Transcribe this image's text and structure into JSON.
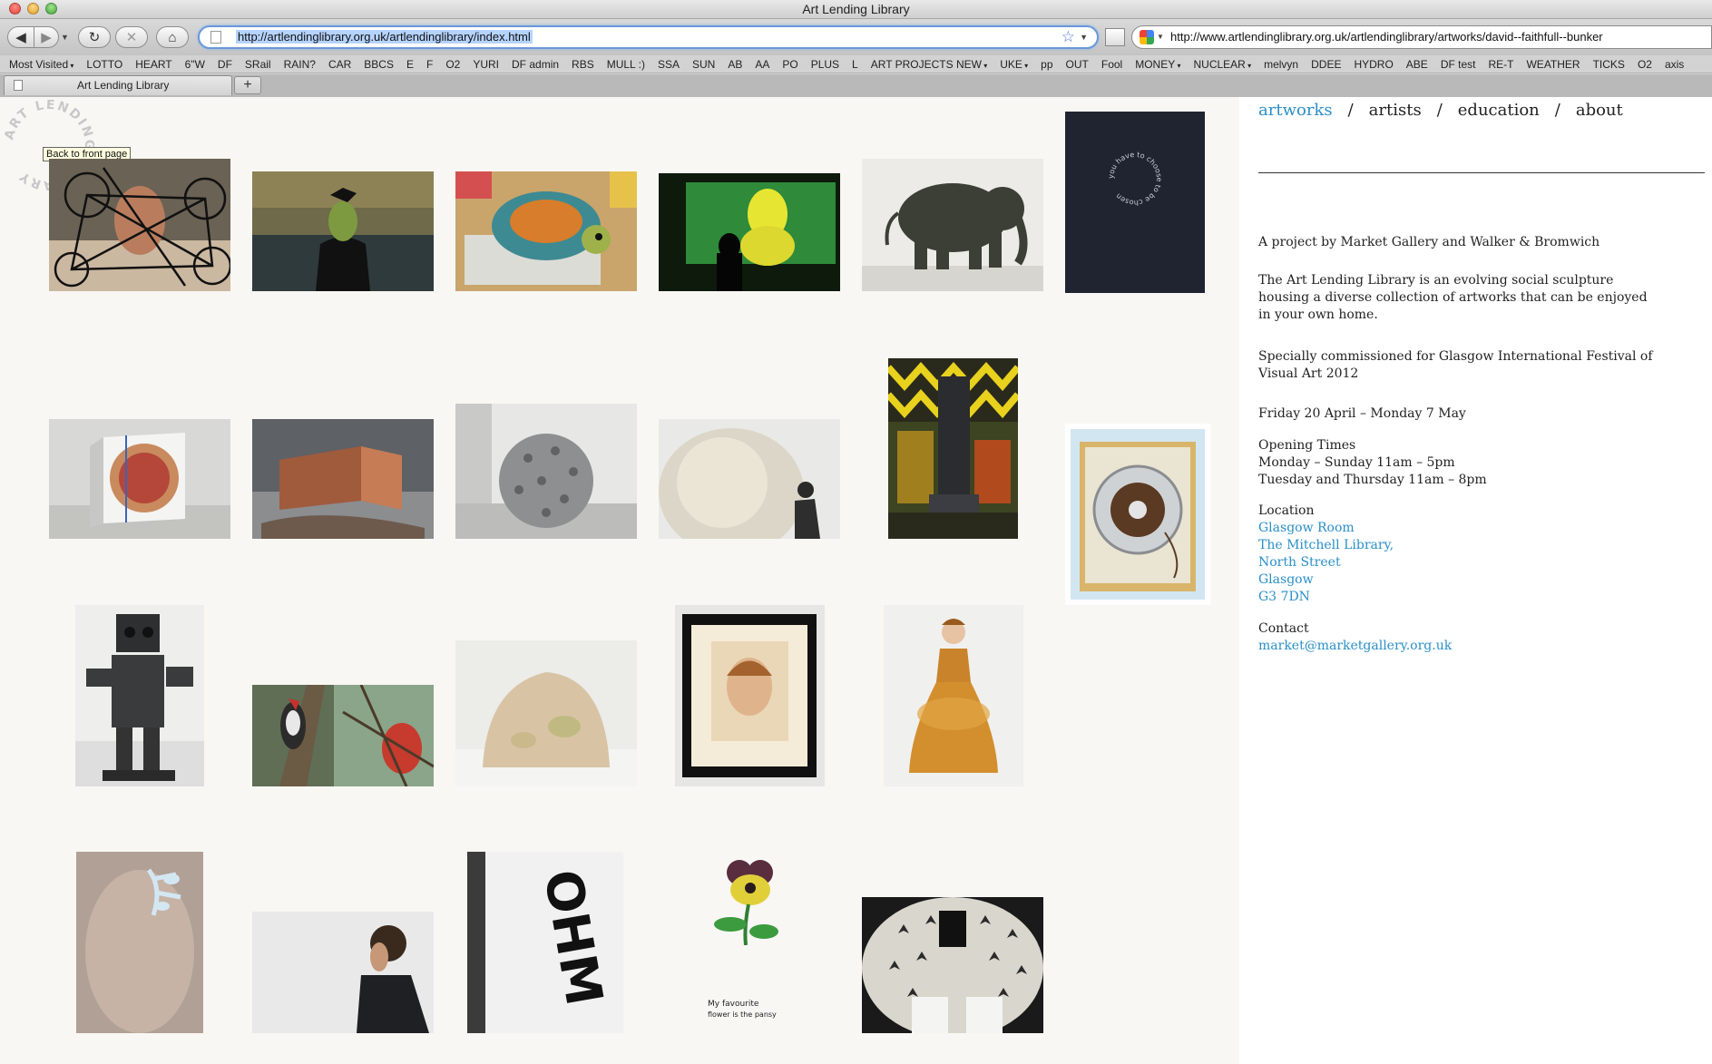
{
  "window": {
    "title": "Art Lending Library"
  },
  "toolbar": {
    "back_label": "◀",
    "forward_label": "▶",
    "reload_label": "↻",
    "stop_label": "✕",
    "home_label": "⌂",
    "url": "http://artlendinglibrary.org.uk/artlendinglibrary/index.html",
    "search_value": "http://www.artlendinglibrary.org.uk/artlendinglibrary/artworks/david--faithfull--bunker"
  },
  "bookmarks": [
    {
      "label": "Most Visited",
      "menu": true
    },
    {
      "label": "LOTTO"
    },
    {
      "label": "HEART"
    },
    {
      "label": "6\"W"
    },
    {
      "label": "DF"
    },
    {
      "label": "SRail"
    },
    {
      "label": "RAIN?"
    },
    {
      "label": "CAR"
    },
    {
      "label": "BBCS"
    },
    {
      "label": "E"
    },
    {
      "label": "F"
    },
    {
      "label": "O2"
    },
    {
      "label": "YURI"
    },
    {
      "label": "DF admin"
    },
    {
      "label": "RBS"
    },
    {
      "label": "MULL :)"
    },
    {
      "label": "SSA"
    },
    {
      "label": "SUN"
    },
    {
      "label": "AB"
    },
    {
      "label": "AA"
    },
    {
      "label": "PO"
    },
    {
      "label": "PLUS"
    },
    {
      "label": "L"
    },
    {
      "label": "ART PROJECTS NEW",
      "menu": true
    },
    {
      "label": "UKE",
      "menu": true
    },
    {
      "label": "pp"
    },
    {
      "label": "OUT"
    },
    {
      "label": "Fool"
    },
    {
      "label": "MONEY",
      "menu": true
    },
    {
      "label": "NUCLEAR",
      "menu": true
    },
    {
      "label": "melvyn"
    },
    {
      "label": "DDEE"
    },
    {
      "label": "HYDRO"
    },
    {
      "label": "ABE"
    },
    {
      "label": "DF test"
    },
    {
      "label": "RE-T"
    },
    {
      "label": "WEATHER"
    },
    {
      "label": "TICKS"
    },
    {
      "label": "O2"
    },
    {
      "label": "axis"
    }
  ],
  "tab": {
    "label": "Art Lending Library",
    "new_tab_label": "+"
  },
  "logo": {
    "text": "ART LENDING LIBRARY"
  },
  "tooltip": "Back to front page",
  "nav": {
    "items": [
      "artworks",
      "artists",
      "education",
      "about"
    ],
    "active": "artworks",
    "separator": "/"
  },
  "info": {
    "intro": "A project by Market Gallery and Walker & Bromwich",
    "description": "The Art Lending Library is an evolving social sculpture housing a diverse collection of artworks that can be enjoyed in your own home.",
    "commission": "Specially commissioned for Glasgow International Festival of Visual Art 2012",
    "dates": "Friday 20 April – Monday 7 May",
    "opening_title": "Opening Times",
    "opening_lines": [
      "Monday – Sunday 11am – 5pm",
      "Tuesday and Thursday 11am – 8pm"
    ],
    "location_title": "Location",
    "location_lines": [
      "Glasgow Room",
      "The Mitchell Library,",
      "North Street",
      "Glasgow",
      "G3 7DN"
    ],
    "contact_title": "Contact",
    "contact_email": "market@marketgallery.org.uk"
  },
  "artwork_texts": {
    "book_circle": "you have to choose to be chosen",
    "ohm": "OHM",
    "flower_caption_1": "My favourite",
    "flower_caption_2": "flower is the pansy"
  },
  "colors": {
    "accent": "#2a8fc7",
    "text": "#222222",
    "page_bg": "#f8f7f3"
  }
}
